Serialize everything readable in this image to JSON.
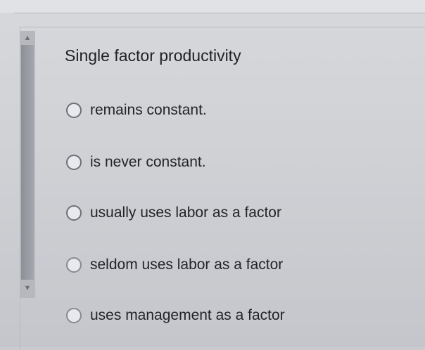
{
  "question": {
    "text": "Single factor productivity"
  },
  "options": [
    {
      "label": "remains constant."
    },
    {
      "label": "is never constant."
    },
    {
      "label": "usually uses labor as a factor"
    },
    {
      "label": "seldom uses labor as a factor"
    },
    {
      "label": "uses management as a factor"
    }
  ],
  "scrollbar": {
    "up_icon": "chevron-up-icon",
    "down_icon": "chevron-down-icon"
  },
  "colors": {
    "background": "#cfd1d5",
    "text": "#1f2023",
    "scroll_thumb": "#a3a6ac"
  }
}
